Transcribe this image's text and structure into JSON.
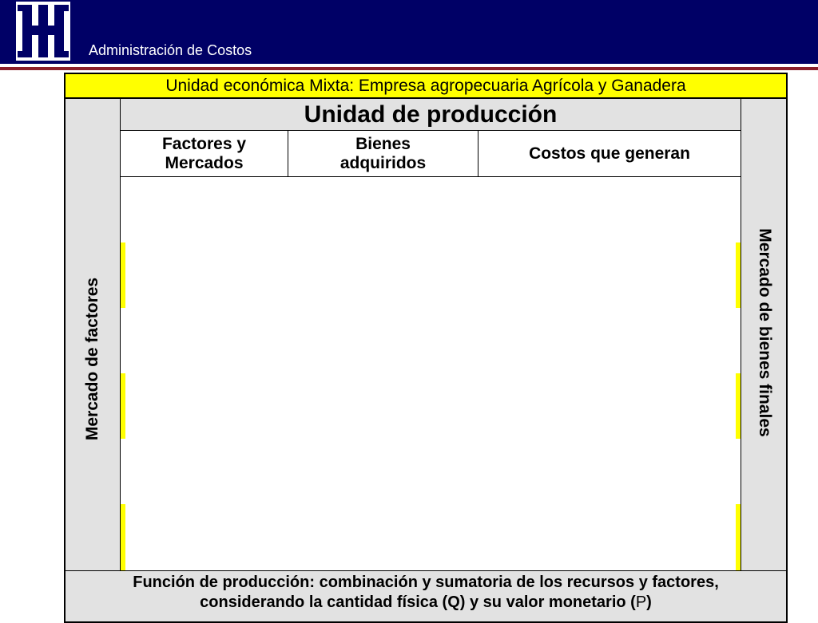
{
  "header": {
    "title": "Administración de Costos",
    "background": "#000066",
    "rule_color": "#8b1f2a"
  },
  "logo": {
    "icon": "utn-logo-icon"
  },
  "table": {
    "banner": "Unidad económica Mixta: Empresa agropecuaria Agrícola y Ganadera",
    "unit_title": "Unidad de producción",
    "left_label": "Mercado de factores",
    "right_label": "Mercado de bienes finales",
    "columns": {
      "c1_line1": "Factores y",
      "c1_line2": "Mercados",
      "c2_line1": "Bienes",
      "c2_line2": "adquiridos",
      "c3": "Costos que generan"
    },
    "footer_line1": "Función de producción: combinación y sumatoria de los recursos y factores,",
    "footer_line2_prefix": "considerando la cantidad física (Q) y su valor monetario (",
    "footer_line2_p": "P",
    "footer_line2_suffix": ")"
  },
  "colors": {
    "banner": "#ffff00",
    "side": "#e2e2e2"
  }
}
